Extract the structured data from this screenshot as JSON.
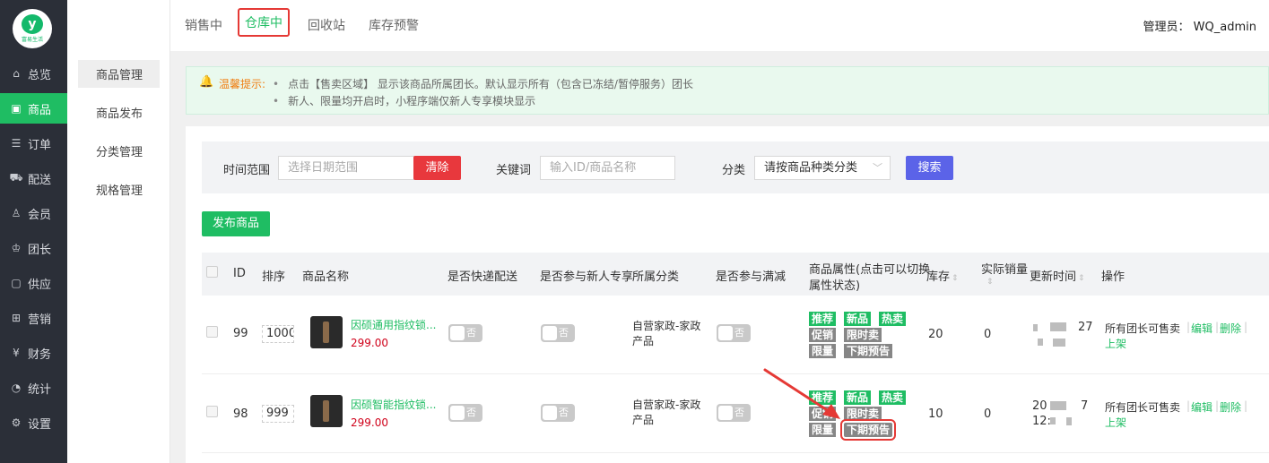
{
  "brand": {
    "logo_mark": "y",
    "logo_text": "富易生活"
  },
  "nav": {
    "items": [
      {
        "label": "总览",
        "icon": "home-icon"
      },
      {
        "label": "商品",
        "icon": "bag-icon"
      },
      {
        "label": "订单",
        "icon": "list-icon"
      },
      {
        "label": "配送",
        "icon": "truck-icon"
      },
      {
        "label": "会员",
        "icon": "user-icon"
      },
      {
        "label": "团长",
        "icon": "leader-icon"
      },
      {
        "label": "供应",
        "icon": "box-icon"
      },
      {
        "label": "营销",
        "icon": "marketing-icon"
      },
      {
        "label": "财务",
        "icon": "finance-icon"
      },
      {
        "label": "统计",
        "icon": "stats-icon"
      },
      {
        "label": "设置",
        "icon": "gear-icon"
      }
    ],
    "active": "商品"
  },
  "subnav": {
    "items": [
      "商品管理",
      "商品发布",
      "分类管理",
      "规格管理"
    ],
    "active": "商品管理"
  },
  "tabs": [
    "销售中",
    "仓库中",
    "回收站",
    "库存预警"
  ],
  "active_tab": "仓库中",
  "admin": "管理员： WQ_admin",
  "tips": {
    "label": "温馨提示:",
    "lines": [
      "点击【售卖区域】 显示该商品所属团长。默认显示所有（包含已冻结/暂停服务）团长",
      "新人、限量均开启时，小程序端仅新人专享模块显示"
    ]
  },
  "filter": {
    "time_label": "时间范围",
    "time_placeholder": "选择日期范围",
    "clear": "清除",
    "keyword_label": "关键词",
    "keyword_placeholder": "输入ID/商品名称",
    "category_label": "分类",
    "category_value": "请按商品种类分类",
    "search": "搜索"
  },
  "publish": "发布商品",
  "table": {
    "headers": {
      "id": "ID",
      "sort": "排序",
      "name": "商品名称",
      "express": "是否快递配送",
      "newcomer": "是否参与新人专享",
      "category": "所属分类",
      "discount": "是否参与满减",
      "attrs_1": "商品属性(点击可以切换",
      "attrs_2": "属性状态)",
      "stock": "库存",
      "sales": "实际销量",
      "updated": "更新时间",
      "ops": "操作"
    },
    "rows": [
      {
        "id": "99",
        "sort": "1000",
        "name": "因硕通用指纹锁...",
        "price": "299.00",
        "express": "否",
        "newcomer": "否",
        "category_1": "自营家政-家政",
        "category_2": "产品",
        "discount": "否",
        "tags": [
          "推荐",
          "新品",
          "热卖",
          "促销",
          "限时卖",
          "限量",
          "下期预告"
        ],
        "stock": "20",
        "sales": "0",
        "updated_tail": "27",
        "op_text": "所有团长可售卖",
        "op_edit": "编辑",
        "op_delete": "删除",
        "op_shelf": "上架"
      },
      {
        "id": "98",
        "sort": "999",
        "name": "因硕智能指纹锁...",
        "price": "299.00",
        "express": "否",
        "newcomer": "否",
        "category_1": "自营家政-家政",
        "category_2": "产品",
        "discount": "否",
        "tags": [
          "推荐",
          "新品",
          "热卖",
          "促销",
          "限时卖",
          "限量",
          "下期预告"
        ],
        "stock": "10",
        "sales": "0",
        "updated_head_1": "20",
        "updated_head_2": "12:",
        "updated_tail": "7",
        "op_text": "所有团长可售卖",
        "op_edit": "编辑",
        "op_delete": "删除",
        "op_shelf": "上架"
      }
    ]
  },
  "colors": {
    "accent": "#1fbd63",
    "danger": "#e8383d",
    "primary": "#5b63e8",
    "sidebar": "#2b2f38"
  }
}
